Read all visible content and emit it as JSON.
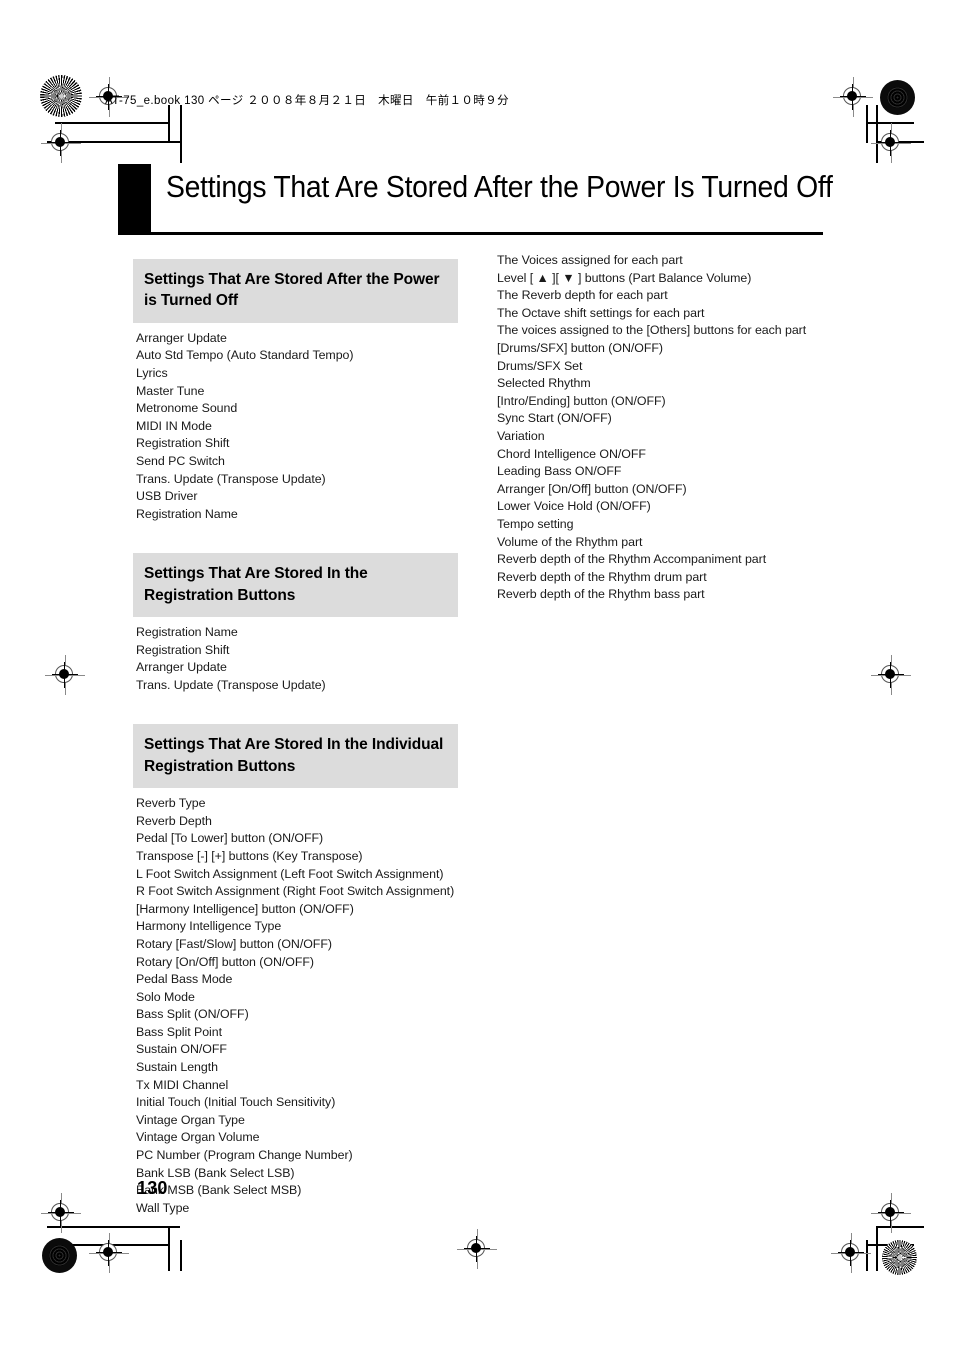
{
  "running_head": "AT-75_e.book  130 ページ  ２００８年８月２１日　木曜日　午前１０時９分",
  "page_title": "Settings That Are Stored After the Power Is Turned Off",
  "folio": "130",
  "left_column": {
    "sections": [
      {
        "heading": "Settings That Are Stored After the Power is Turned Off",
        "items": [
          "Arranger Update",
          "Auto Std Tempo (Auto Standard Tempo)",
          "Lyrics",
          "Master Tune",
          "Metronome Sound",
          "MIDI IN Mode",
          "Registration Shift",
          "Send PC Switch",
          "Trans. Update (Transpose Update)",
          "USB Driver",
          "Registration Name"
        ]
      },
      {
        "heading": "Settings That Are Stored In the Registration Buttons",
        "items": [
          "Registration Name",
          "Registration Shift",
          "Arranger Update",
          "Trans. Update (Transpose Update)"
        ]
      },
      {
        "heading": "Settings That Are Stored In the Individual Registration Buttons",
        "items": [
          "Reverb Type",
          "Reverb Depth",
          "Pedal [To Lower] button (ON/OFF)",
          "Transpose [-] [+] buttons (Key Transpose)",
          "L Foot Switch Assignment (Left Foot Switch Assignment)",
          "R Foot Switch Assignment (Right Foot Switch Assignment)",
          "[Harmony Intelligence] button (ON/OFF)",
          "Harmony Intelligence Type",
          "Rotary [Fast/Slow] button (ON/OFF)",
          "Rotary [On/Off] button (ON/OFF)",
          "Pedal Bass Mode",
          "Solo Mode",
          "Bass Split (ON/OFF)",
          "Bass Split Point",
          "Sustain ON/OFF",
          "Sustain Length",
          "Tx MIDI Channel",
          "Initial Touch (Initial Touch Sensitivity)",
          "Vintage Organ Type",
          "Vintage Organ Volume",
          "PC Number (Program Change Number)",
          "Bank LSB (Bank Select LSB)",
          "Bank MSB (Bank Select MSB)",
          "Wall Type"
        ]
      }
    ]
  },
  "right_column": {
    "items": [
      "The Voices assigned for each part",
      "Level [ ▲ ][ ▼ ] buttons (Part Balance Volume)",
      "The Reverb depth for each part",
      "The Octave shift settings for each part",
      "The voices assigned to the [Others] buttons for each part",
      "[Drums/SFX] button (ON/OFF)",
      "Drums/SFX Set",
      "Selected Rhythm",
      "[Intro/Ending] button (ON/OFF)",
      "Sync Start (ON/OFF)",
      "Variation",
      "Chord Intelligence ON/OFF",
      "Leading Bass ON/OFF",
      "Arranger [On/Off] button (ON/OFF)",
      "Lower Voice Hold (ON/OFF)",
      "Tempo setting",
      "Volume of the Rhythm part",
      "Reverb depth of the Rhythm Accompaniment part",
      "Reverb depth of the Rhythm drum part",
      "Reverb depth of the Rhythm bass part"
    ]
  }
}
